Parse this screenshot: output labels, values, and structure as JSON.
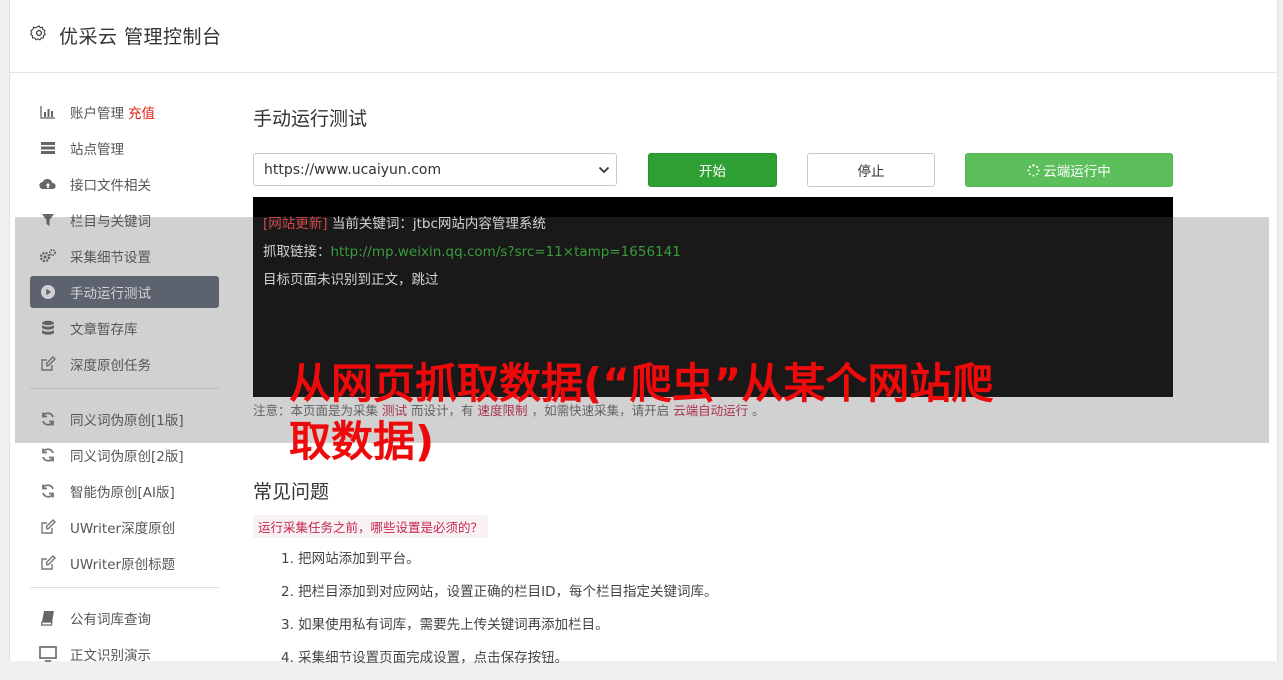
{
  "header": {
    "title": "优采云 管理控制台",
    "icon": "gear-icon"
  },
  "sidebar": {
    "groups": [
      [
        {
          "label": "账户管理",
          "tag": "充值",
          "icon": "bar-chart-icon"
        },
        {
          "label": "站点管理",
          "icon": "server-icon"
        },
        {
          "label": "接口文件相关",
          "icon": "cloud-upload-icon"
        },
        {
          "label": "栏目与关键词",
          "icon": "filter-icon"
        },
        {
          "label": "采集细节设置",
          "icon": "gears-icon"
        },
        {
          "label": "手动运行测试",
          "icon": "play-circle-icon",
          "active": true
        },
        {
          "label": "文章暂存库",
          "icon": "database-icon"
        },
        {
          "label": "深度原创任务",
          "icon": "edit-icon"
        }
      ],
      [
        {
          "label": "同义词伪原创[1版]",
          "icon": "refresh-icon"
        },
        {
          "label": "同义词伪原创[2版]",
          "icon": "refresh-icon"
        },
        {
          "label": "智能伪原创[AI版]",
          "icon": "refresh-icon"
        },
        {
          "label": "UWriter深度原创",
          "icon": "edit-icon"
        },
        {
          "label": "UWriter原创标题",
          "icon": "edit-icon"
        }
      ],
      [
        {
          "label": "公有词库查询",
          "icon": "book-icon"
        },
        {
          "label": "正文识别演示",
          "icon": "monitor-icon"
        }
      ]
    ]
  },
  "main": {
    "title": "手动运行测试",
    "site_select": {
      "value": "https://www.ucaiyun.com"
    },
    "buttons": {
      "start": "开始",
      "stop": "停止",
      "cloud": "云端运行中"
    },
    "console": {
      "line1_tag": "[网站更新]",
      "line1_text": "当前关键词：jtbc网站内容管理系统",
      "line2_label": "抓取链接：",
      "line2_link": "http://mp.weixin.qq.com/s?src=11×tamp=1656141",
      "line3_text": "目标页面未识别到正文，跳过"
    },
    "note": {
      "prefix": "注意：本页面是为采集",
      "hl1": "测试",
      "mid1": "而设计，有",
      "hl2": "速度限制",
      "mid2": "，如需快速采集，请开启",
      "hl3": "云端自动运行",
      "suffix": "。"
    },
    "faq": {
      "title": "常见问题",
      "question": "运行采集任务之前，哪些设置是必须的？",
      "steps": [
        "1. 把网站添加到平台。",
        "2. 把栏目添加到对应网站，设置正确的栏目ID，每个栏目指定关键词库。",
        "3. 如果使用私有词库，需要先上传关键词再添加栏目。",
        "4. 采集细节设置页面完成设置，点击保存按钮。"
      ]
    }
  },
  "overlay_caption": "从网页抓取数据(“爬虫”从某个网站爬取数据)",
  "colors": {
    "start": "#2e9f32",
    "cloud": "#5cbf5c",
    "active_nav": "#5d6778",
    "caption": "#ee0a0a",
    "tag": "#e0261a"
  }
}
